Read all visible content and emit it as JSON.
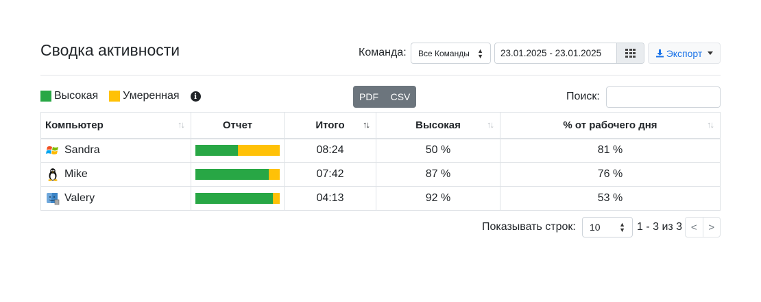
{
  "header": {
    "title": "Сводка активности",
    "team_label": "Команда:",
    "team_value": "Все Команды",
    "date_range": "23.01.2025 - 23.01.2025",
    "export_label": "Экспорт"
  },
  "legend": {
    "items": [
      {
        "label": "Высокая",
        "color": "#28a745"
      },
      {
        "label": "Умеренная",
        "color": "#ffc107"
      }
    ]
  },
  "toolbar": {
    "pdf_label": "PDF",
    "csv_label": "CSV",
    "search_label": "Поиск:",
    "search_value": ""
  },
  "table": {
    "columns": [
      "Компьютер",
      "Отчет",
      "Итого",
      "Высокая",
      "% от рабочего дня"
    ],
    "sorted_column": "Итого",
    "rows": [
      {
        "computer": "Sandra",
        "os": "windows-icon",
        "high_fraction": 0.5,
        "total": "08:24",
        "high": "50 %",
        "workday": "81 %"
      },
      {
        "computer": "Mike",
        "os": "linux-icon",
        "high_fraction": 0.87,
        "total": "07:42",
        "high": "87 %",
        "workday": "76 %"
      },
      {
        "computer": "Valery",
        "os": "mac-icon",
        "high_fraction": 0.92,
        "total": "04:13",
        "high": "92 %",
        "workday": "53 %"
      }
    ]
  },
  "pagination": {
    "rows_label": "Показывать строк:",
    "page_size": "10",
    "range": "1 - 3 из 3",
    "prev": "<",
    "next": ">"
  },
  "colors": {
    "high": "#28a745",
    "moderate": "#ffc107",
    "accent": "#1a73e8"
  }
}
